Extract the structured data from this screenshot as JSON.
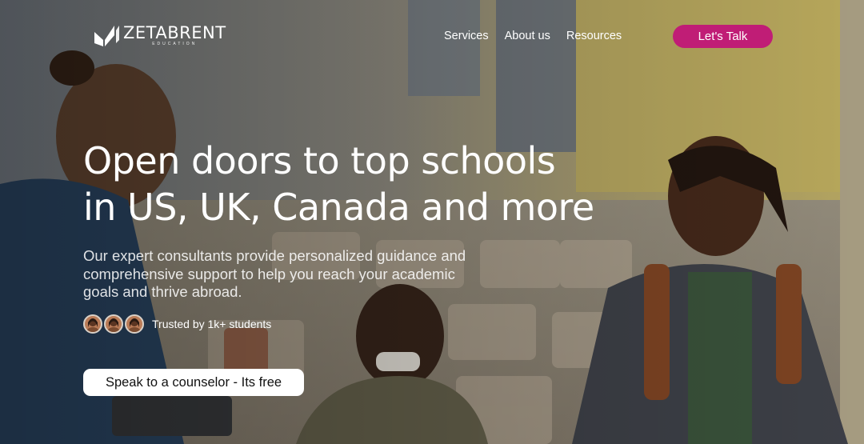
{
  "brand": {
    "name": "ZETABRENT",
    "tagline": "EDUCATION",
    "logo_icon": "book-leaf-icon"
  },
  "nav": {
    "links": [
      "Services",
      "About us",
      "Resources"
    ],
    "cta_label": "Let's Talk"
  },
  "hero": {
    "headline_line1": "Open doors to top schools",
    "headline_line2": "in US, UK, Canada and more",
    "subtext": "Our expert consultants provide personalized guidance and comprehensive support to help you reach your academic goals and thrive abroad.",
    "trust_text": "Trusted by 1k+ students",
    "cta_label": "Speak to a counselor - Its free"
  },
  "colors": {
    "accent": "#c01d76",
    "cta_text": "#111111"
  }
}
